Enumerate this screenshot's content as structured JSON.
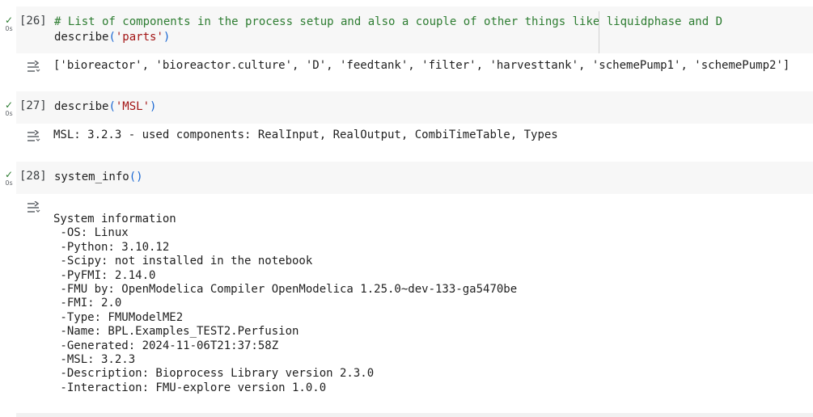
{
  "cells": [
    {
      "exec_count": "[26]",
      "time": "0s",
      "comment": "# List of components in the process setup and also a couple of other things like liquidphase and D",
      "call_fn": "describe",
      "call_open": "(",
      "call_arg": "'parts'",
      "call_close": ")",
      "output": "['bioreactor', 'bioreactor.culture', 'D', 'feedtank', 'filter', 'harvesttank', 'schemePump1', 'schemePump2']"
    },
    {
      "exec_count": "[27]",
      "time": "0s",
      "call_fn": "describe",
      "call_open": "(",
      "call_arg": "'MSL'",
      "call_close": ")",
      "output": "MSL: 3.2.3 - used components: RealInput, RealOutput, CombiTimeTable, Types"
    },
    {
      "exec_count": "[28]",
      "time": "0s",
      "call_fn": "system_info",
      "call_parens": "()",
      "output_lines": [
        "System information",
        " -OS: Linux",
        " -Python: 3.10.12",
        " -Scipy: not installed in the notebook",
        " -PyFMI: 2.14.0",
        " -FMU by: OpenModelica Compiler OpenModelica 1.25.0~dev-133-ga5470be",
        " -FMI: 2.0",
        " -Type: FMUModelME2",
        " -Name: BPL.Examples_TEST2.Perfusion",
        " -Generated: 2024-11-06T21:37:58Z",
        " -MSL: 3.2.3",
        " -Description: Bioprocess Library version 2.3.0",
        " -Interaction: FMU-explore version 1.0.0"
      ]
    }
  ],
  "icons": {
    "status": "check-icon",
    "output_toggle": "output-toggle-icon"
  },
  "colors": {
    "cell_background": "#f7f7f7",
    "check": "#2e7d32",
    "comment": "#2e7d32",
    "string": "#a31515",
    "paren": "#1967d2"
  }
}
